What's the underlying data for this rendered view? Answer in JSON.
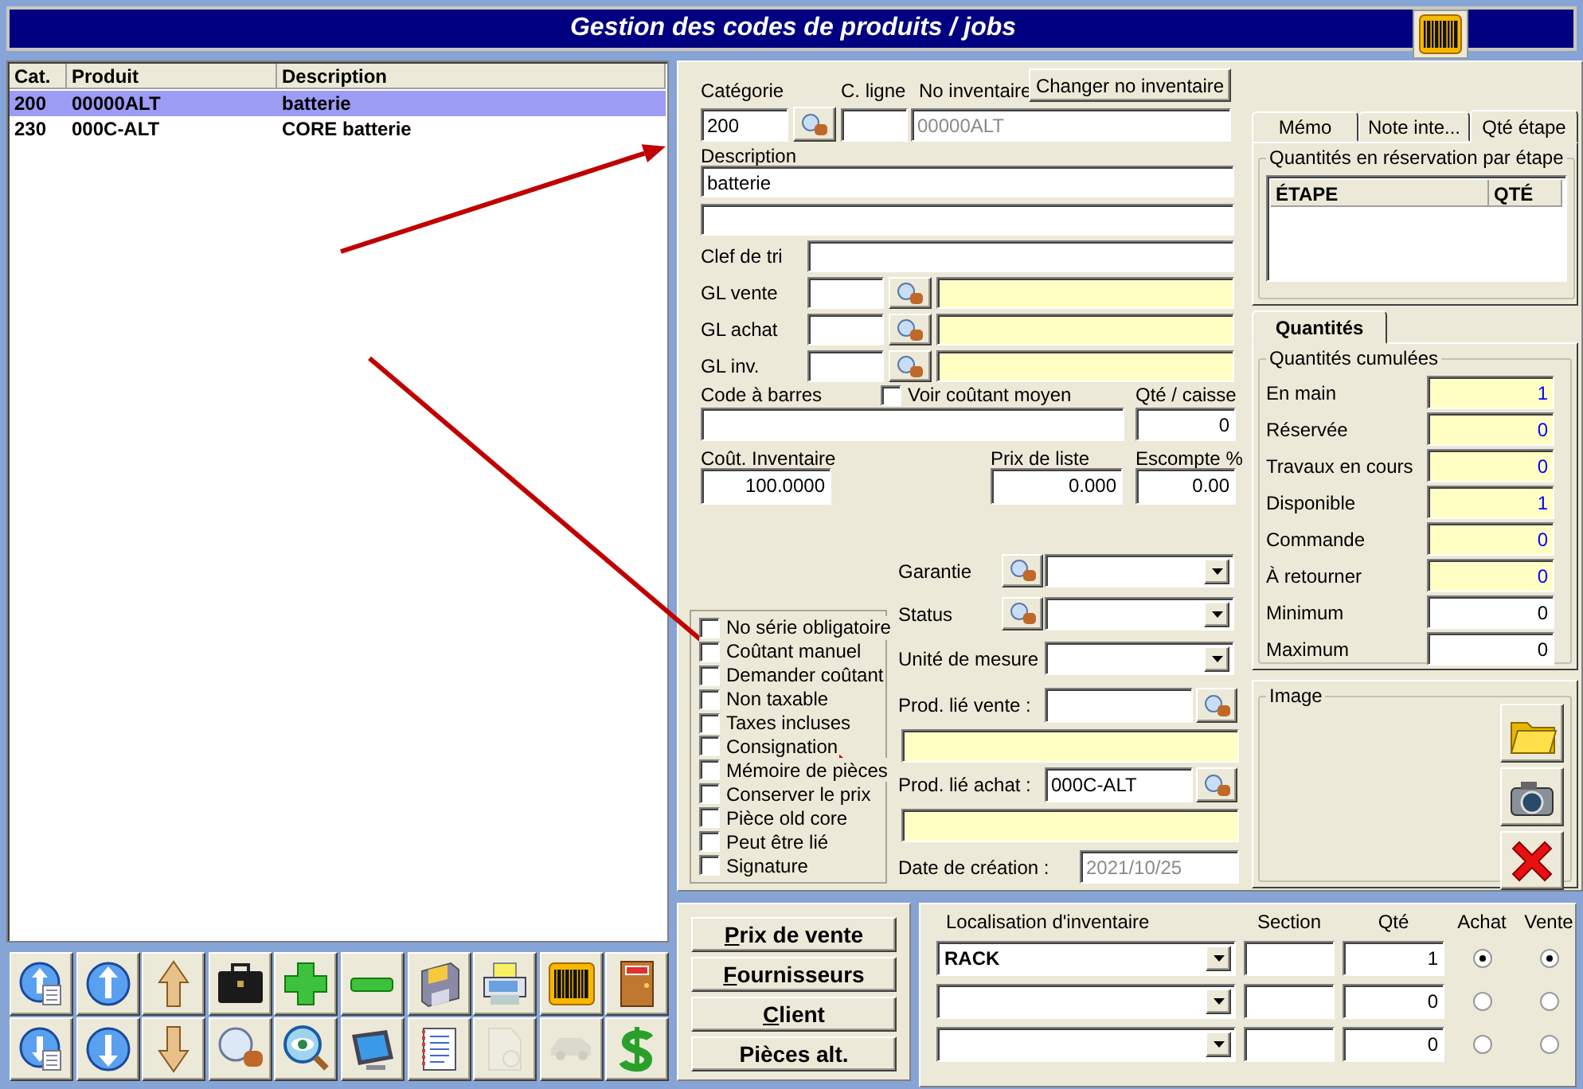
{
  "window": {
    "title": "Gestion des codes de produits / jobs"
  },
  "product_list": {
    "columns": [
      "Cat.",
      "Produit",
      "Description"
    ],
    "rows": [
      {
        "cells": [
          "200",
          "00000ALT",
          "batterie"
        ],
        "selected": true
      },
      {
        "cells": [
          "230",
          "000C-ALT",
          "CORE batterie"
        ],
        "selected": false
      }
    ]
  },
  "toolbar": [
    {
      "kind": "first",
      "disabled": false
    },
    {
      "kind": "previous",
      "disabled": false
    },
    {
      "kind": "up",
      "disabled": false
    },
    {
      "kind": "briefcase",
      "disabled": false
    },
    {
      "kind": "add",
      "disabled": false
    },
    {
      "kind": "remove",
      "disabled": false
    },
    {
      "kind": "save",
      "disabled": false
    },
    {
      "kind": "print",
      "disabled": false
    },
    {
      "kind": "barcode",
      "disabled": false
    },
    {
      "kind": "exit",
      "disabled": false
    },
    {
      "kind": "last",
      "disabled": false
    },
    {
      "kind": "next",
      "disabled": false
    },
    {
      "kind": "down",
      "disabled": false
    },
    {
      "kind": "search",
      "disabled": false
    },
    {
      "kind": "view",
      "disabled": false
    },
    {
      "kind": "monitor",
      "disabled": false
    },
    {
      "kind": "list",
      "disabled": false
    },
    {
      "kind": "sketch",
      "disabled": true
    },
    {
      "kind": "car",
      "disabled": true
    },
    {
      "kind": "price",
      "disabled": false
    }
  ],
  "form": {
    "category": {
      "label": "Catégorie",
      "value": "200"
    },
    "line_code": {
      "label": "C. ligne"
    },
    "inventory_no": {
      "label": "No inventaire",
      "value": "00000ALT",
      "disabled": true
    },
    "change_button": "Changer no inventaire",
    "description": {
      "label": "Description",
      "value": "batterie"
    },
    "sort_key": {
      "label": "Clef de tri"
    },
    "gl_accounts": [
      {
        "label": "GL vente"
      },
      {
        "label": "GL achat"
      },
      {
        "label": "GL inv."
      }
    ],
    "barcode": {
      "label": "Code à barres"
    },
    "average_cost": {
      "label": "Voir coûtant moyen",
      "checked": false
    },
    "case_qty": {
      "label": "Qté / caisse",
      "value": "0"
    },
    "inventory_cost": {
      "label": "Coût. Inventaire",
      "value": "100.0000"
    },
    "list_price": {
      "label": "Prix de liste",
      "value": "0.000"
    },
    "discount": {
      "label": "Escompte %",
      "value": "0.00"
    },
    "options": [
      {
        "label": "No série obligatoire",
        "checked": false
      },
      {
        "label": "Coûtant manuel",
        "checked": false
      },
      {
        "label": "Demander coûtant",
        "checked": false
      },
      {
        "label": "Non taxable",
        "checked": false
      },
      {
        "label": "Taxes incluses",
        "checked": false
      },
      {
        "label": "Consignation",
        "checked": false
      },
      {
        "label": "Mémoire de pièces",
        "checked": false
      },
      {
        "label": "Conserver le prix",
        "checked": false
      },
      {
        "label": "Pièce old core",
        "checked": false
      },
      {
        "label": "Peut être lié",
        "checked": false
      },
      {
        "label": "Signature",
        "checked": false
      }
    ],
    "warranty": {
      "label": "Garantie"
    },
    "status": {
      "label": "Status"
    },
    "unit": {
      "label": "Unité de mesure"
    },
    "linked_sale": {
      "label": "Prod. lié vente :"
    },
    "linked_purchase": {
      "label": "Prod. lié achat :",
      "value": "000C-ALT"
    },
    "created": {
      "label": "Date de création :",
      "value": "2021/10/25",
      "disabled": true
    }
  },
  "side_tabs": [
    {
      "label": "Mémo",
      "selected": false
    },
    {
      "label": "Note inte...",
      "selected": false
    },
    {
      "label": "Qté étape",
      "selected": true
    }
  ],
  "stage_reservations": {
    "title": "Quantités en réservation par étape",
    "columns": [
      "ÉTAPE",
      "QTÉ"
    ]
  },
  "quantity_tabs": [
    {
      "label": "Quantités",
      "selected": true
    }
  ],
  "quantities": {
    "title": "Quantités cumulées",
    "rows": [
      {
        "label": "En main",
        "value": "1",
        "kind": "computed"
      },
      {
        "label": "Réservée",
        "value": "0",
        "kind": "computed"
      },
      {
        "label": "Travaux en cours",
        "value": "0",
        "kind": "computed"
      },
      {
        "label": "Disponible",
        "value": "1",
        "kind": "computed"
      },
      {
        "label": "Commande",
        "value": "0",
        "kind": "computed"
      },
      {
        "label": "À retourner",
        "value": "0",
        "kind": "computed"
      },
      {
        "label": "Minimum",
        "value": "0",
        "kind": "editable"
      },
      {
        "label": "Maximum",
        "value": "0",
        "kind": "editable"
      }
    ]
  },
  "image": {
    "title": "Image"
  },
  "side_buttons": [
    {
      "label": "Prix de vente",
      "underline_first": true
    },
    {
      "label": "Fournisseurs",
      "underline_first": true
    },
    {
      "label": "Client",
      "underline_first": true
    },
    {
      "label": "Pièces alt.",
      "underline_first": false
    }
  ],
  "locations": {
    "columns": [
      "Localisation d'inventaire",
      "Section",
      "Qté",
      "Achat",
      "Vente"
    ],
    "rows": [
      {
        "location": "RACK",
        "qty": "1",
        "purchase_selected": true,
        "sale_selected": true
      },
      {
        "qty": "0",
        "purchase_selected": false,
        "sale_selected": false
      },
      {
        "qty": "0",
        "purchase_selected": false,
        "sale_selected": false
      }
    ]
  },
  "annotations": [
    {
      "kind": "arrow"
    },
    {
      "kind": "arrow"
    }
  ]
}
